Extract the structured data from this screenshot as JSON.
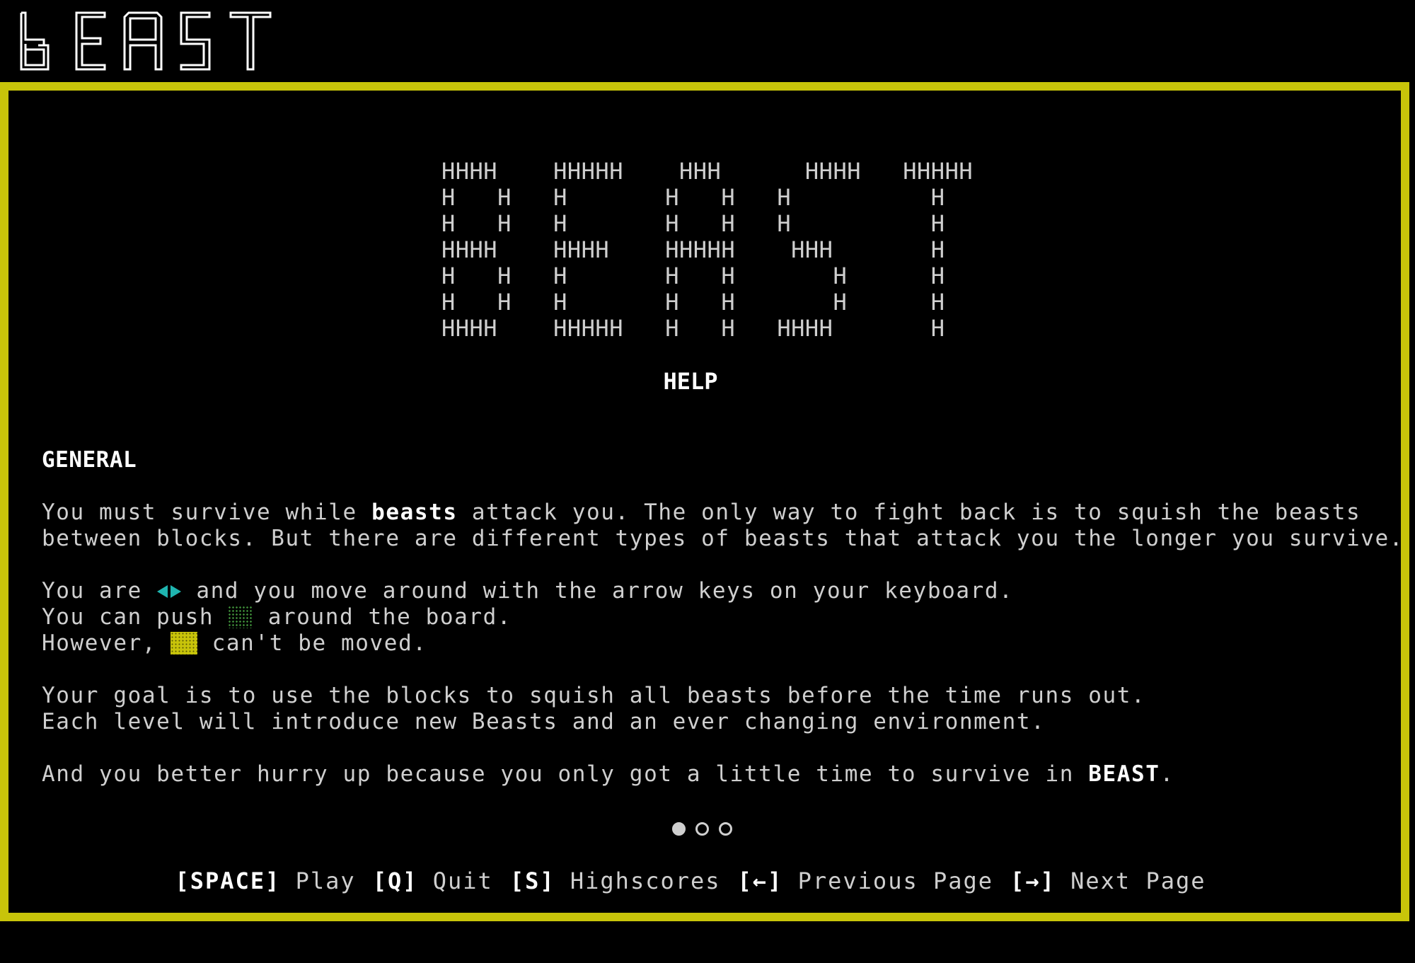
{
  "app": {
    "logo_text": "BEAST",
    "accent_color": "#c8c40a"
  },
  "banner": {
    "ascii_lines": [
      "HHHH    HHHHH    HHH      HHHH   HHHHH",
      "H   H   H       H   H   H          H",
      "H   H   H       H   H   H          H",
      "HHHH    HHHH    HHHHH    HHH       H",
      "H   H   H       H   H       H      H",
      "H   H   H       H   H       H      H",
      "HHHH    HHHHH   H   H   HHHH       H"
    ],
    "title": "HELP"
  },
  "general": {
    "heading": "GENERAL",
    "p1_a": "You must survive while ",
    "p1_bold": "beasts",
    "p1_b": " attack you. The only way to fight back is to squish the beasts",
    "p1_c": "between blocks. But there are different types of beasts that attack you the longer you survive.",
    "p2_a": "You are ",
    "p2_b": " and you move around with the arrow keys on your keyboard.",
    "p3_a": "You can push ",
    "p3_b": " around the board.",
    "p4_a": "However, ",
    "p4_b": " can't be moved.",
    "p5": "Your goal is to use the blocks to squish all beasts before the time runs out.",
    "p6": "Each level will introduce new Beasts and an ever changing environment.",
    "p7_a": "And you better hurry up because you only got a little time to survive in ",
    "p7_bold": "BEAST",
    "p7_b": ".",
    "player_icon": "player-diamond-icon",
    "player_color": "#1fb5b0",
    "push_block_icon": "pushable-block-icon",
    "push_block_color": "#3f8f3a",
    "solid_block_icon": "solid-block-icon",
    "solid_block_color": "#c8c40a"
  },
  "pagination": {
    "pages": 3,
    "current": 1
  },
  "footer": {
    "space_key": "[SPACE]",
    "space_label": "Play",
    "q_key": "[Q]",
    "q_label": "Quit",
    "s_key": "[S]",
    "s_label": "Highscores",
    "left_key": "[←]",
    "left_label": "Previous Page",
    "right_key": "[→]",
    "right_label": "Next Page"
  }
}
